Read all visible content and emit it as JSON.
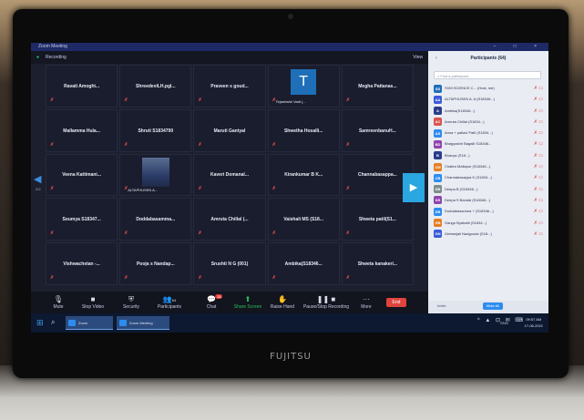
{
  "laptop": {
    "brand": "FUJITSU"
  },
  "window": {
    "title": "Zoom Meeting",
    "controls": "– □ ×"
  },
  "meeting_bar": {
    "recording": "Recording",
    "view_label": "View"
  },
  "gallery": {
    "page_indicator": "2/2",
    "tiles": [
      {
        "name": "Ravati Amoghi...",
        "muted": true
      },
      {
        "name": "ShreedeviLH.pgl...",
        "muted": true
      },
      {
        "name": "Praveen s goud...",
        "muted": true
      },
      {
        "name": "",
        "avatar": "T",
        "caption": "Tejashwini Vadi (...",
        "muted": true
      },
      {
        "name": "Megha Pattanas...",
        "muted": true
      },
      {
        "name": "Mallamma Hula...",
        "muted": true
      },
      {
        "name": "Shruti S1834790",
        "muted": true
      },
      {
        "name": "Maruti Gantyal",
        "muted": true
      },
      {
        "name": "Shwetha Hosalli...",
        "muted": true
      },
      {
        "name": "SamreenbanuH...",
        "muted": true
      },
      {
        "name": "Veena Kattimani...",
        "muted": true
      },
      {
        "name": "",
        "video": true,
        "caption": "ALTAPHUSEN A...",
        "muted": true
      },
      {
        "name": "Kaveri Domanal...",
        "muted": true
      },
      {
        "name": "Kirankumar B K...",
        "muted": true
      },
      {
        "name": "Channabasappa...",
        "muted": true
      },
      {
        "name": "Soumya S18347...",
        "muted": true
      },
      {
        "name": "Doddabasamma...",
        "muted": true
      },
      {
        "name": "Amruta Chillal (...",
        "muted": true
      },
      {
        "name": "Vaishali MS (S18...",
        "muted": true
      },
      {
        "name": "Shweta patil(S1...",
        "muted": true
      },
      {
        "name": "Vishwachetan -...",
        "muted": true
      },
      {
        "name": "Pooja s Nandap...",
        "muted": true
      },
      {
        "name": "Srushti N G (001)",
        "muted": true
      },
      {
        "name": "Ambika(S18346...",
        "muted": true
      },
      {
        "name": "Shweta kanakeri...",
        "muted": true
      }
    ]
  },
  "toolbar": {
    "mute": "Mute",
    "stop_video": "Stop Video",
    "security": "Security",
    "participants": "Participants",
    "participants_count": "64",
    "chat": "Chat",
    "chat_badge": "18",
    "share_screen": "Share Screen",
    "raise_hand": "Raise Hand",
    "recording": "Pause/Stop Recording",
    "more": "More",
    "end": "End"
  },
  "participants_panel": {
    "title": "Participants (64)",
    "search_placeholder": "Find a participant",
    "items": [
      {
        "initials": "SS",
        "name": "SVM SCIENCE C... (Host, me)",
        "color": "#1e6fb8"
      },
      {
        "initials": "AA",
        "name": "ALTAPHUSEN A. A (S18346...)",
        "color": "#3a5bd9"
      },
      {
        "initials": "A",
        "name": "Ambika(S18346...)",
        "color": "#2a3c8a"
      },
      {
        "initials": "AC",
        "name": "Amruta Chillal (S1834...)",
        "color": "#d9534f"
      },
      {
        "initials": "AS",
        "name": "Anna + pallavi Patil (S1834...)",
        "color": "#2d8cf0"
      },
      {
        "initials": "BD",
        "name": "Bhagyashri Bagalli S18346...",
        "color": "#8e44ad"
      },
      {
        "initials": "B",
        "name": "Bhavya (S18...)",
        "color": "#2a3c8a"
      },
      {
        "initials": "CM",
        "name": "Chaitra Mallapur (S18346...)",
        "color": "#e67e22"
      },
      {
        "initials": "CB",
        "name": "Channabasappa K (S1834...)",
        "color": "#2d8cf0"
      },
      {
        "initials": "DB",
        "name": "Deepa B (S18346...)",
        "color": "#7f8c8d"
      },
      {
        "initials": "DS",
        "name": "Deepa S Bandal (S18346...)",
        "color": "#8e44ad"
      },
      {
        "initials": "DB",
        "name": "Doddabasamma + (S18346...)",
        "color": "#2d8cf0"
      },
      {
        "initials": "GB",
        "name": "Gangu Byahatti (S1834...)",
        "color": "#e67e22"
      },
      {
        "initials": "GN",
        "name": "Geetanjali Nadgouda (S18...)",
        "color": "#3a5bd9"
      }
    ],
    "invite": "Invite",
    "mute_all": "Mute All"
  },
  "taskbar": {
    "apps": [
      "Zoom",
      "Zoom Meeting"
    ],
    "tray": "^ ▲ ⊡ ✉ ⌨",
    "lang": "ENG",
    "time": "09:57 AM",
    "date": "17-06-2021"
  }
}
